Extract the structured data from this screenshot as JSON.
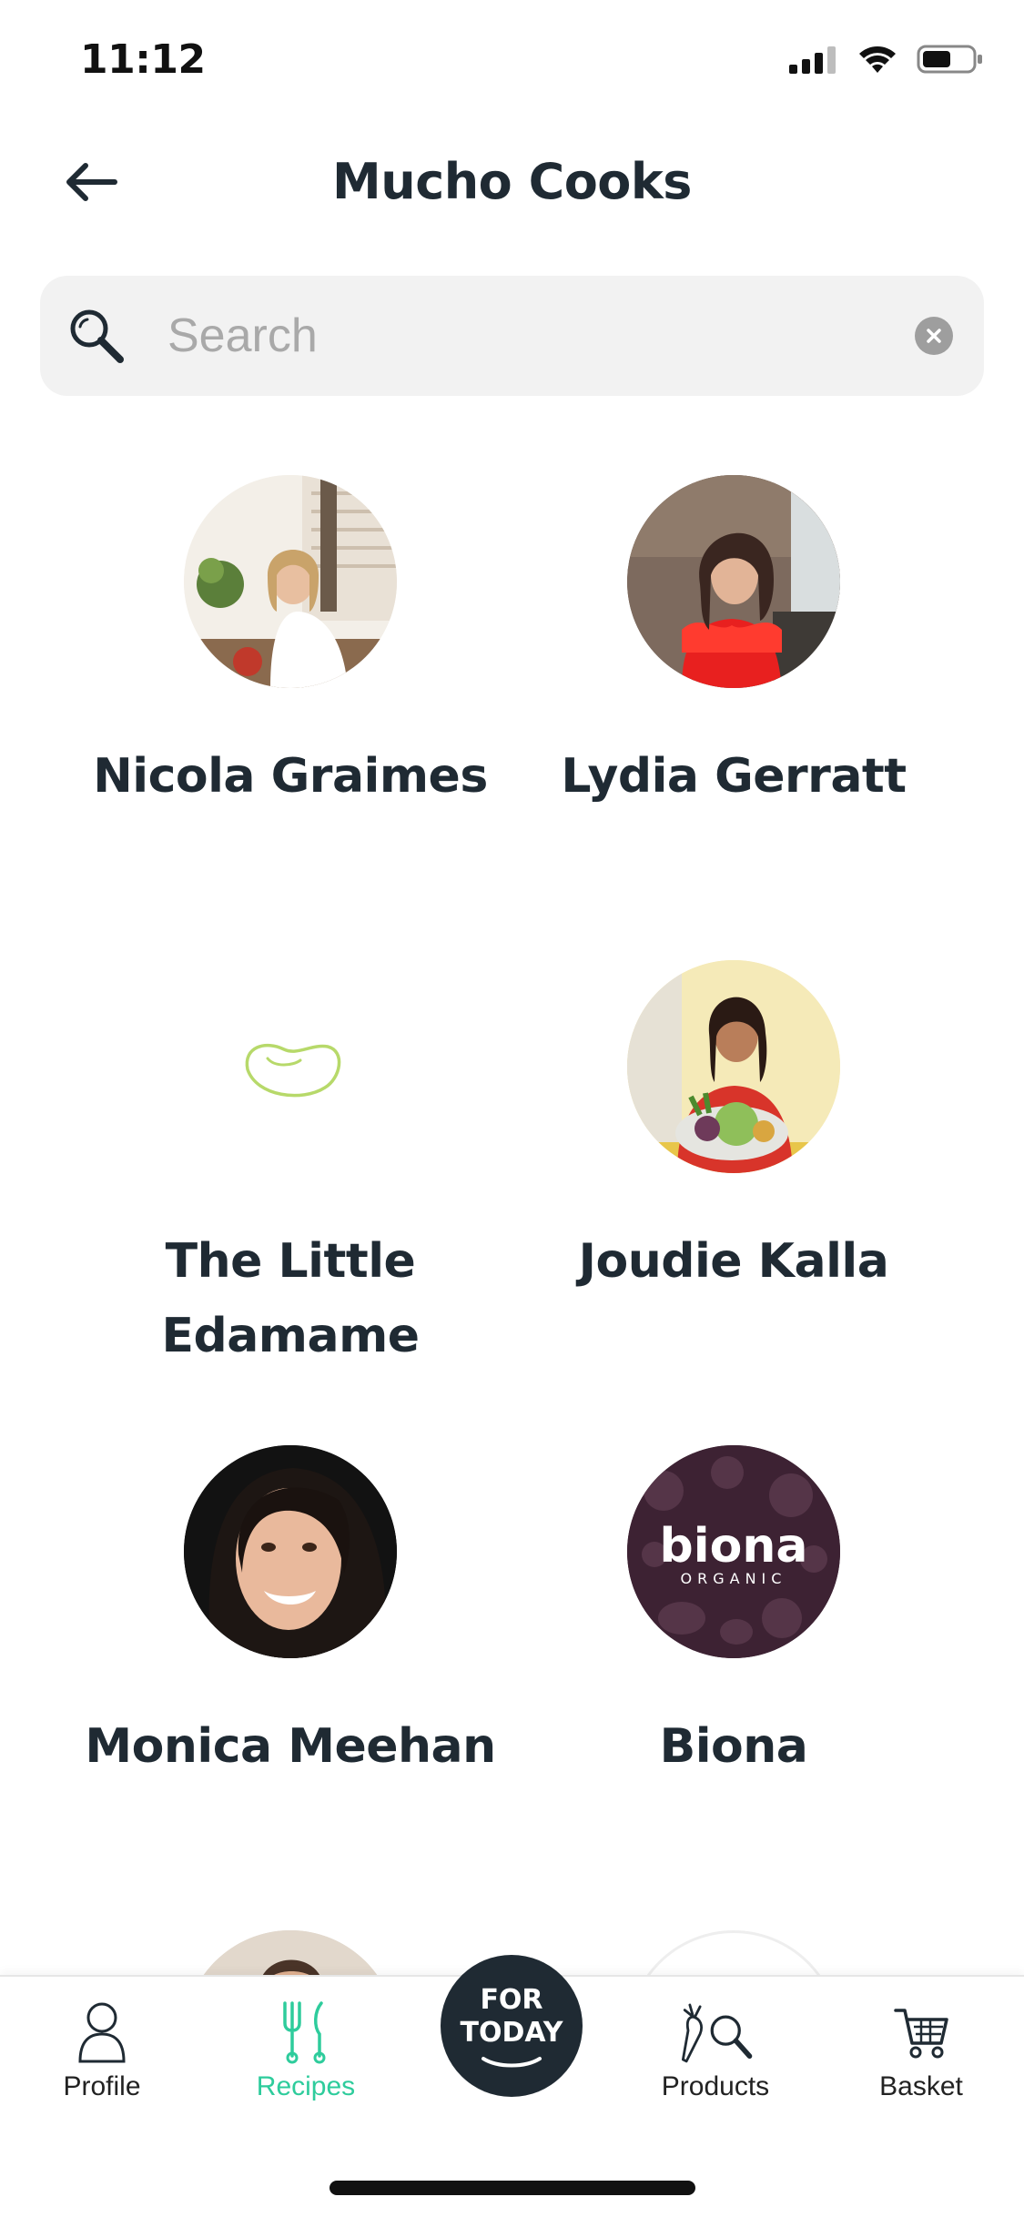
{
  "status_bar": {
    "time": "11:12"
  },
  "header": {
    "title": "Mucho Cooks",
    "back_icon": "arrow-left-icon"
  },
  "search": {
    "placeholder": "Search",
    "value": ""
  },
  "cooks": [
    {
      "name": "Nicola Graimes",
      "avatar": "photo"
    },
    {
      "name": "Lydia Gerratt",
      "avatar": "photo"
    },
    {
      "name": "The Little Edamame",
      "avatar": "edamame-bean-icon"
    },
    {
      "name": "Joudie Kalla",
      "avatar": "photo"
    },
    {
      "name": "Monica Meehan",
      "avatar": "photo"
    },
    {
      "name": "Biona",
      "avatar": "biona-logo",
      "logo_text": "biona",
      "logo_subtext": "ORGANIC"
    }
  ],
  "tabs": [
    {
      "label": "Profile",
      "icon": "person-icon",
      "active": false
    },
    {
      "label": "Recipes",
      "icon": "fork-knife-icon",
      "active": true
    },
    {
      "label": "FOR TODAY",
      "line1": "FOR",
      "line2": "TODAY",
      "icon": "for-today-badge"
    },
    {
      "label": "Products",
      "icon": "carrot-magnifier-icon",
      "active": false
    },
    {
      "label": "Basket",
      "icon": "cart-icon",
      "active": false
    }
  ],
  "colors": {
    "accent": "#2ecc9c",
    "title": "#1f2a33",
    "search_bg": "#f2f2f2"
  }
}
